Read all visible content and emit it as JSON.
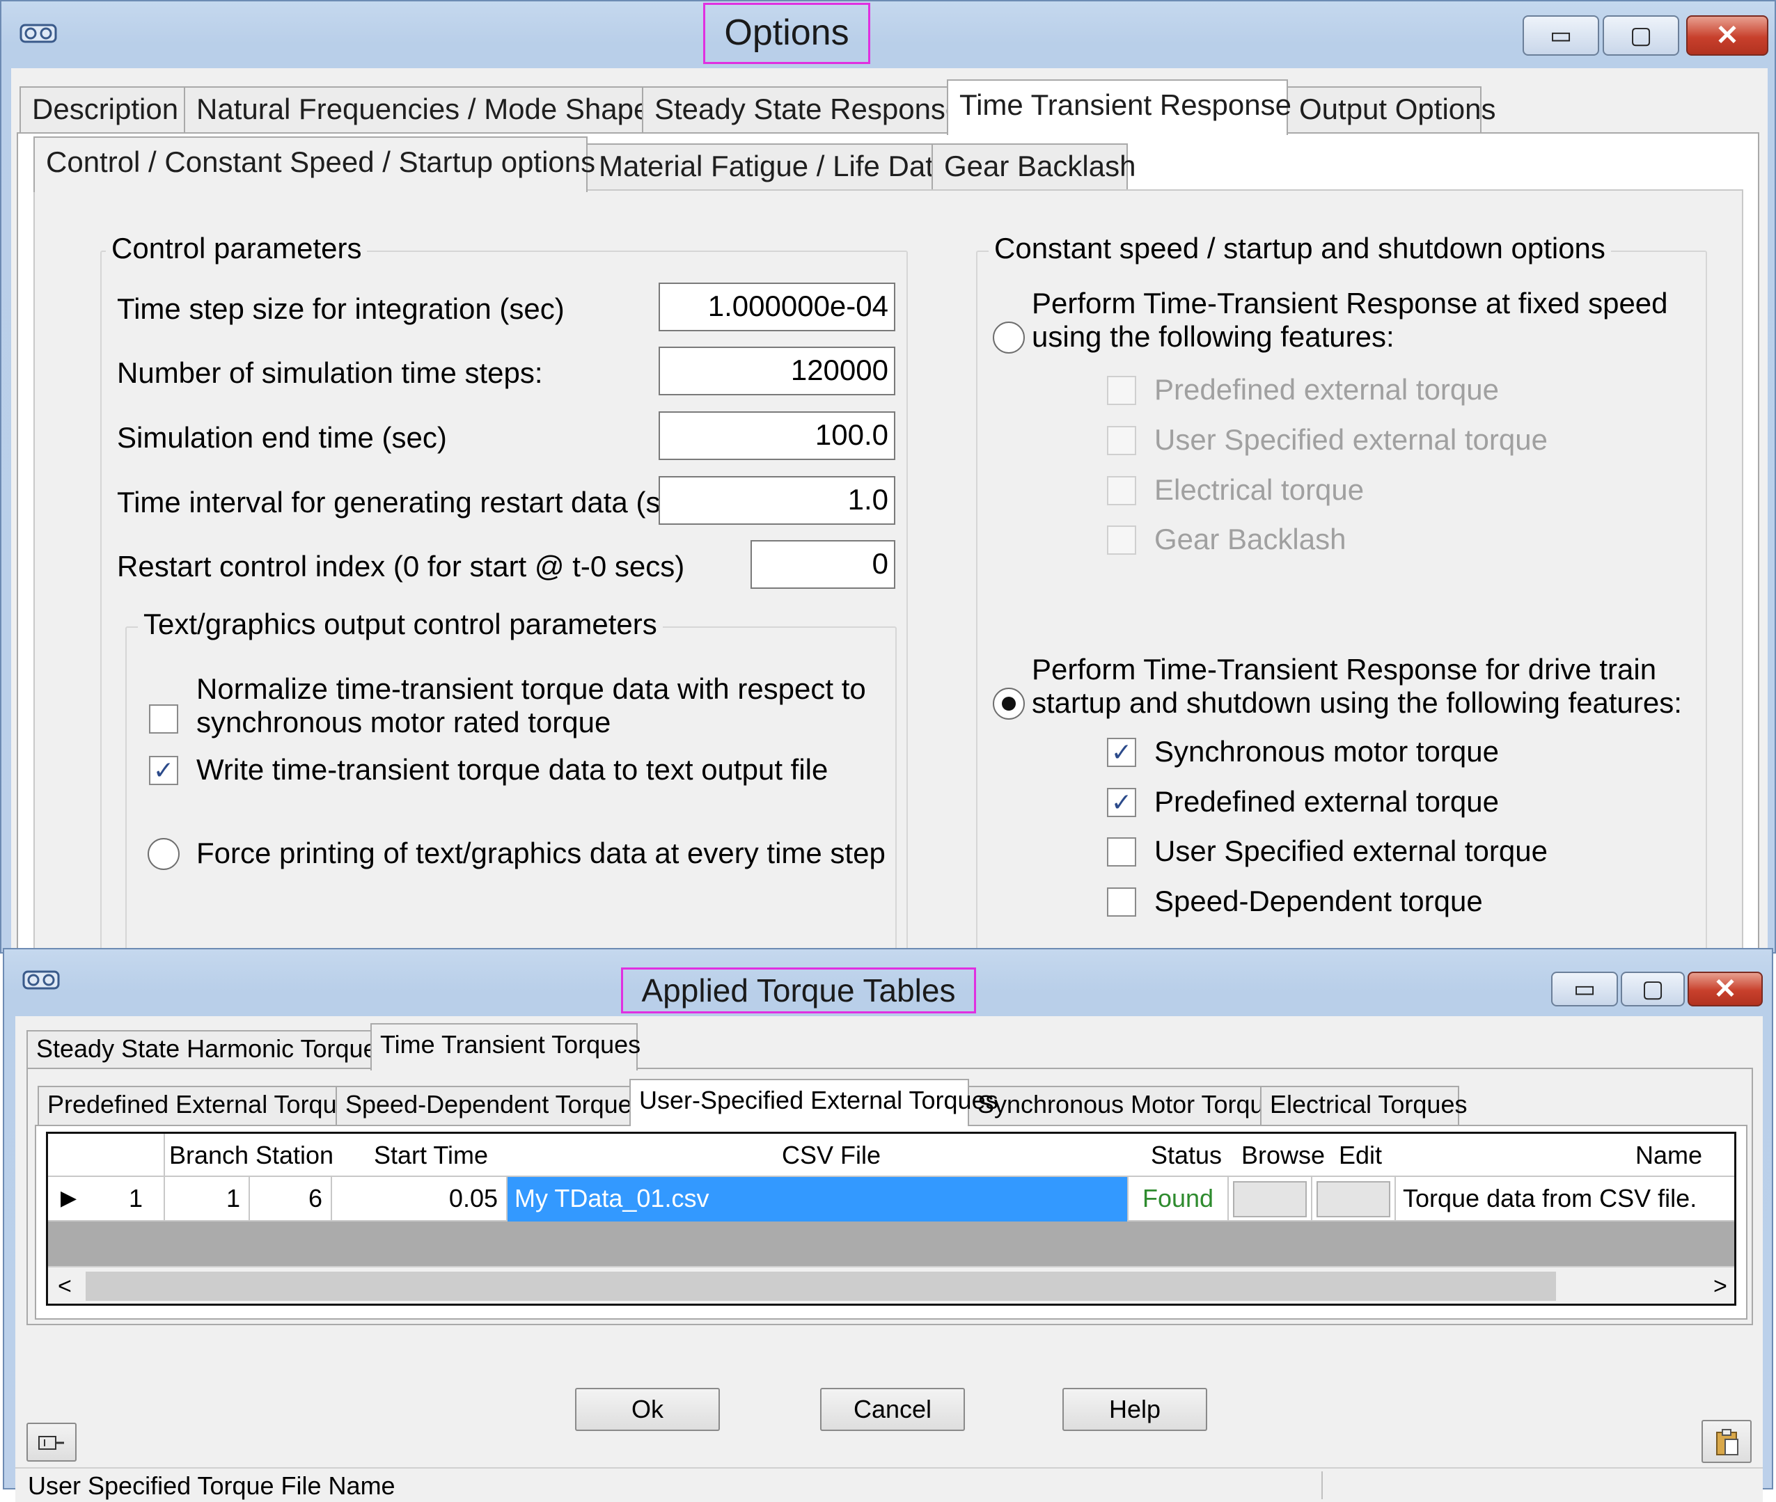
{
  "options_window": {
    "title": "Options",
    "icon": "app-gear-icon",
    "titlebar_buttons": {
      "minimize": "minimize-icon",
      "maximize": "maximize-icon",
      "close": "close-icon"
    },
    "main_tabs": [
      "Description",
      "Natural Frequencies / Mode Shapes",
      "Steady State Response",
      "Time Transient Response",
      "Output Options"
    ],
    "active_main_tab": "Time Transient Response",
    "sub_tabs": [
      "Control / Constant Speed / Startup options",
      "Material Fatigue / Life Data",
      "Gear Backlash"
    ],
    "active_sub_tab": "Control / Constant Speed / Startup options",
    "control_params": {
      "group_label": "Control parameters",
      "fields": [
        {
          "label": "Time step size for integration (sec)",
          "value": "1.000000e-04"
        },
        {
          "label": "Number of simulation time steps:",
          "value": "120000"
        },
        {
          "label": "Simulation end time (sec)",
          "value": "100.0"
        },
        {
          "label": "Time interval for generating restart data (sec)",
          "value": "1.0"
        },
        {
          "label": "Restart control index (0 for start @ t-0 secs)",
          "value": "0"
        }
      ],
      "output_group": {
        "group_label": "Text/graphics output control parameters",
        "normalize_label_1": "Normalize time-transient torque data with respect to",
        "normalize_label_2": "synchronous motor rated torque",
        "normalize_checked": false,
        "write_label": "Write time-transient torque data to text output file",
        "write_checked": true,
        "force_label": "Force printing of text/graphics data at every time step"
      }
    },
    "constant_speed": {
      "group_label": "Constant speed / startup and shutdown options",
      "fixed_speed_label_1": "Perform Time-Transient Response at fixed speed",
      "fixed_speed_label_2": "using the following features:",
      "fixed_features": [
        "Predefined external torque",
        "User Specified external torque",
        "Electrical torque",
        "Gear Backlash"
      ],
      "startup_label_1": "Perform Time-Transient Response for drive train",
      "startup_label_2": "startup and shutdown using the following features:",
      "startup_features": [
        {
          "label": "Synchronous motor torque",
          "checked": true
        },
        {
          "label": "Predefined external torque",
          "checked": true
        },
        {
          "label": "User Specified external torque",
          "checked": false
        },
        {
          "label": "Speed-Dependent torque",
          "checked": false
        }
      ],
      "selected_option": "startup"
    }
  },
  "torque_window": {
    "title": "Applied Torque Tables",
    "icon": "app-gear-icon",
    "tabs": [
      "Steady State Harmonic Torques",
      "Time Transient Torques"
    ],
    "active_tab": "Time Transient Torques",
    "sub_tabs": [
      "Predefined External Torques",
      "Speed-Dependent Torques",
      "User-Specified External Torques",
      "Synchronous Motor Torques",
      "Electrical Torques"
    ],
    "active_sub_tab": "User-Specified External Torques",
    "grid": {
      "columns": [
        "Branch",
        "Station",
        "Start Time",
        "CSV File",
        "Status",
        "Browse",
        "Edit",
        "Name"
      ],
      "rows": [
        {
          "row_header": "1",
          "branch": "1",
          "station": "6",
          "start_time": "0.05",
          "csv_file": "My TData_01.csv",
          "status": "Found",
          "name": "Torque data from CSV file."
        }
      ],
      "scroll_left": "<",
      "scroll_right": ">"
    },
    "buttons": {
      "ok": "Ok",
      "cancel": "Cancel",
      "help": "Help"
    },
    "status_bar": "User Specified Torque File Name",
    "colors": {
      "selection": "#3399ff",
      "found": "#2e8b2e",
      "highlight": "#e030e0"
    }
  }
}
